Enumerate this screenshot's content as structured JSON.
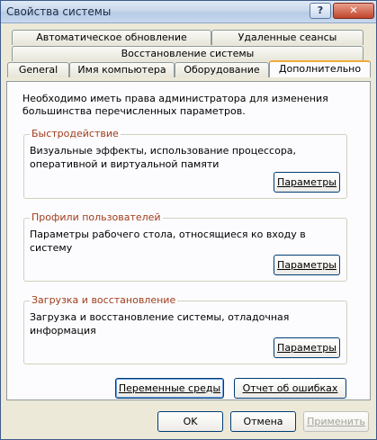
{
  "window": {
    "title": "Свойства системы",
    "help_label": "?",
    "close_label": "✕"
  },
  "tabs": {
    "row1": [
      "Автоматическое обновление",
      "Удаленные сеансы"
    ],
    "row2": [
      "Восстановление системы"
    ],
    "row3": [
      "General",
      "Имя компьютера",
      "Оборудование",
      "Дополнительно"
    ]
  },
  "note": "Необходимо иметь права администратора для изменения большинства перечисленных параметров.",
  "groups": [
    {
      "title": "Быстродействие",
      "desc": "Визуальные эффекты, использование процессора, оперативной и виртуальной памяти",
      "button": "Параметры"
    },
    {
      "title": "Профили пользователей",
      "desc": "Параметры рабочего стола, относящиеся ко входу в систему",
      "button": "Параметры"
    },
    {
      "title": "Загрузка и восстановление",
      "desc": "Загрузка и восстановление системы, отладочная информация",
      "button": "Параметры"
    }
  ],
  "bottom_buttons": {
    "env": "Переменные среды",
    "errors": "Отчет об ошибках"
  },
  "dialog_buttons": {
    "ok": "OK",
    "cancel": "Отмена",
    "apply": "Применить"
  }
}
